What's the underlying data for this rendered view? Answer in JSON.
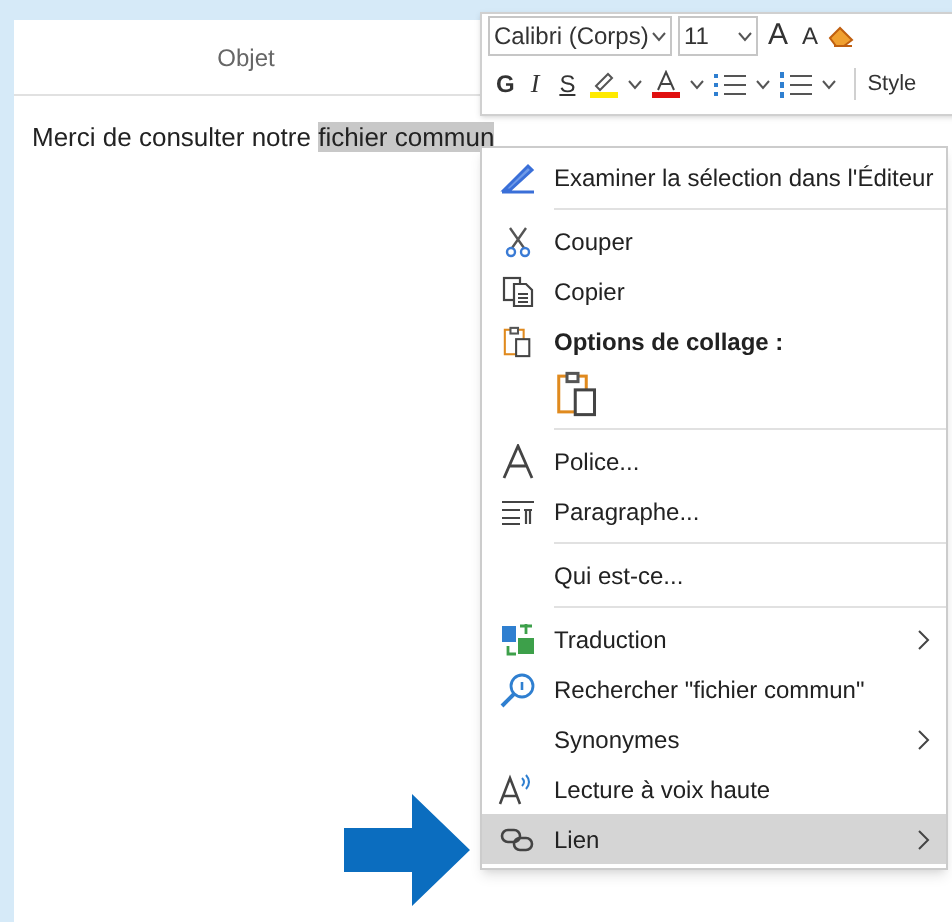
{
  "message": {
    "subject_label": "Objet",
    "body_before": "Merci de consulter notre ",
    "selection": "fichier commun"
  },
  "mini_toolbar": {
    "font": "Calibri (Corps)",
    "size": "11",
    "grow": "A",
    "shrink": "A",
    "bold": "G",
    "italic": "I",
    "underline": "S",
    "styles": "Style"
  },
  "context_menu": [
    {
      "kind": "item",
      "label": "Examiner la sélection dans l'Éditeur",
      "submenu": false,
      "selected": false
    },
    {
      "kind": "separator"
    },
    {
      "kind": "item",
      "label": "Couper",
      "submenu": false,
      "selected": false
    },
    {
      "kind": "item",
      "label": "Copier",
      "submenu": false,
      "selected": false
    },
    {
      "kind": "header",
      "label": "Options de collage :"
    },
    {
      "kind": "paste"
    },
    {
      "kind": "separator"
    },
    {
      "kind": "item",
      "label": "Police...",
      "submenu": false,
      "selected": false
    },
    {
      "kind": "item",
      "label": "Paragraphe...",
      "submenu": false,
      "selected": false
    },
    {
      "kind": "separator"
    },
    {
      "kind": "item",
      "label": "Qui est-ce...",
      "submenu": false,
      "selected": false
    },
    {
      "kind": "separator"
    },
    {
      "kind": "item",
      "label": "Traduction",
      "submenu": true,
      "selected": false
    },
    {
      "kind": "item",
      "label": "Rechercher \"fichier commun\"",
      "submenu": false,
      "selected": false
    },
    {
      "kind": "item",
      "label": "Synonymes",
      "submenu": true,
      "selected": false
    },
    {
      "kind": "item",
      "label": "Lecture à voix haute",
      "submenu": false,
      "selected": false
    },
    {
      "kind": "item",
      "label": "Lien",
      "submenu": true,
      "selected": true
    }
  ]
}
